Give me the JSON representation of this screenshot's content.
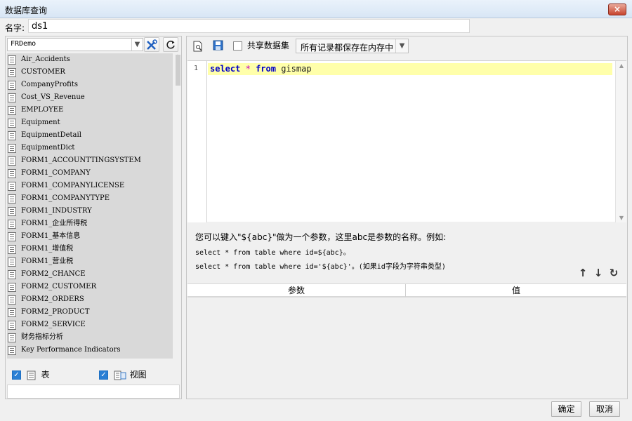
{
  "window": {
    "title": "数据库查询",
    "close_glyph": "×"
  },
  "name_field": {
    "label": "名字:",
    "value": "ds1"
  },
  "datasource": {
    "selected": "FRDemo",
    "tables": [
      "Air_Accidents",
      "CUSTOMER",
      "CompanyProfits",
      "Cost_VS_Revenue",
      "EMPLOYEE",
      "Equipment",
      "EquipmentDetail",
      "EquipmentDict",
      "FORM1_ACCOUNTTINGSYSTEM",
      "FORM1_COMPANY",
      "FORM1_COMPANYLICENSE",
      "FORM1_COMPANYTYPE",
      "FORM1_INDUSTRY",
      "FORM1_企业所得税",
      "FORM1_基本信息",
      "FORM1_增值税",
      "FORM1_营业税",
      "FORM2_CHANCE",
      "FORM2_CUSTOMER",
      "FORM2_ORDERS",
      "FORM2_PRODUCT",
      "FORM2_SERVICE",
      "财务指标分析",
      "Key Performance Indicators"
    ],
    "show_tables_label": "表",
    "show_views_label": "视图"
  },
  "query_toolbar": {
    "share_label": "共享数据集",
    "storage_mode": "所有记录都保存在内存中"
  },
  "editor": {
    "line_number": "1",
    "sql": {
      "kw1": "select",
      "op": "*",
      "kw2": "from",
      "table": "gismap"
    }
  },
  "hint": {
    "line1": "您可以键入\"${abc}\"做为一个参数，这里abc是参数的名称。例如:",
    "line2": "select * from table where id=${abc}。",
    "line3": "select * from table where id='${abc}'。(如果id字段为字符串类型)"
  },
  "params": {
    "col_param": "参数",
    "col_value": "值"
  },
  "buttons": {
    "ok": "确定",
    "cancel": "取消"
  }
}
